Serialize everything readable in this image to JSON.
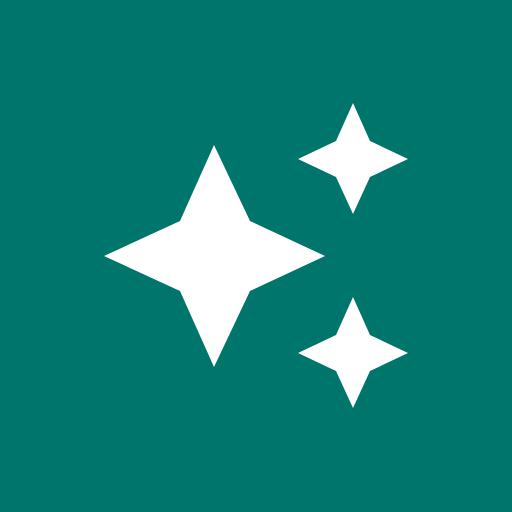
{
  "icon": {
    "name": "sparkles-icon",
    "background_color": "#00756c",
    "foreground_color": "#ffffff"
  }
}
